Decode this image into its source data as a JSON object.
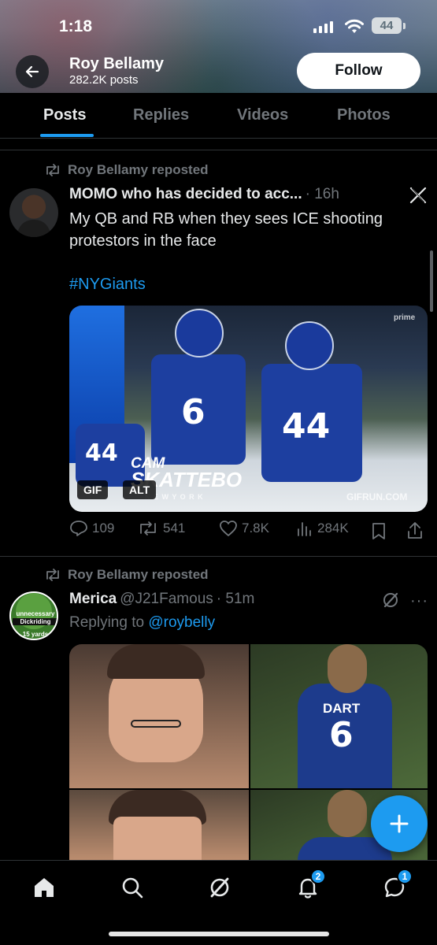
{
  "status_bar": {
    "time": "1:18",
    "battery": "44"
  },
  "header": {
    "profile_name": "Roy Bellamy",
    "post_count": "282.2K posts",
    "follow_label": "Follow"
  },
  "tabs": [
    {
      "label": "Posts",
      "active": true
    },
    {
      "label": "Replies",
      "active": false
    },
    {
      "label": "Videos",
      "active": false
    },
    {
      "label": "Photos",
      "active": false
    }
  ],
  "posts": [
    {
      "repost_label": "Roy Bellamy reposted",
      "author": "MOMO who has decided to acc...",
      "time": "· 16h",
      "text": "My QB and RB when they sees ICE shooting protestors in the face",
      "hashtag": "#NYGiants",
      "media": {
        "badge_gif": "GIF",
        "badge_alt": "ALT",
        "overlay_line1": "CAM",
        "overlay_line2": "SKATTEBO",
        "overlay_sub": "N E W   Y O R K",
        "watermark": "GIFRUN.COM",
        "prime": "prime",
        "numbers": [
          "6",
          "44",
          "44"
        ]
      },
      "actions": {
        "replies": "109",
        "reposts": "541",
        "likes": "7.8K",
        "views": "284K"
      }
    },
    {
      "repost_label": "Roy Bellamy reposted",
      "author": "Merica",
      "handle": "@J21Famous",
      "time": "· 51m",
      "reply_prefix": "Replying to",
      "reply_to": "@roybelly",
      "avatar_text": [
        "unnecessary",
        "Dickriding",
        "15 yards"
      ],
      "media": {
        "jersey_name": "DART",
        "jersey_number": "6"
      }
    }
  ],
  "nav": {
    "notifications_badge": "2",
    "messages_badge": "1"
  }
}
